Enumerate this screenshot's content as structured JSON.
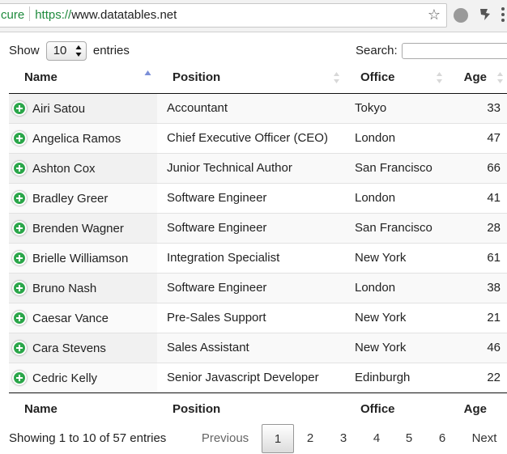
{
  "browser": {
    "secure_label": "cure",
    "url_scheme": "https://",
    "url_host": "www.datatables.net",
    "icons": [
      "star-icon",
      "extension-icon",
      "pin-extension-icon",
      "menu-icon"
    ]
  },
  "controls": {
    "length_prefix": "Show",
    "length_value": "10",
    "length_suffix": "entries",
    "search_label": "Search:",
    "search_value": ""
  },
  "table": {
    "columns": [
      {
        "label": "Name",
        "sorted": "asc"
      },
      {
        "label": "Position"
      },
      {
        "label": "Office"
      },
      {
        "label": "Age"
      }
    ],
    "rows": [
      {
        "name": "Airi Satou",
        "position": "Accountant",
        "office": "Tokyo",
        "age": "33"
      },
      {
        "name": "Angelica Ramos",
        "position": "Chief Executive Officer (CEO)",
        "office": "London",
        "age": "47"
      },
      {
        "name": "Ashton Cox",
        "position": "Junior Technical Author",
        "office": "San Francisco",
        "age": "66"
      },
      {
        "name": "Bradley Greer",
        "position": "Software Engineer",
        "office": "London",
        "age": "41"
      },
      {
        "name": "Brenden Wagner",
        "position": "Software Engineer",
        "office": "San Francisco",
        "age": "28"
      },
      {
        "name": "Brielle Williamson",
        "position": "Integration Specialist",
        "office": "New York",
        "age": "61"
      },
      {
        "name": "Bruno Nash",
        "position": "Software Engineer",
        "office": "London",
        "age": "38"
      },
      {
        "name": "Caesar Vance",
        "position": "Pre-Sales Support",
        "office": "New York",
        "age": "21"
      },
      {
        "name": "Cara Stevens",
        "position": "Sales Assistant",
        "office": "New York",
        "age": "46"
      },
      {
        "name": "Cedric Kelly",
        "position": "Senior Javascript Developer",
        "office": "Edinburgh",
        "age": "22"
      }
    ],
    "footer": [
      "Name",
      "Position",
      "Office",
      "Age"
    ]
  },
  "info": "Showing 1 to 10 of 57 entries",
  "pagination": {
    "previous": "Previous",
    "pages": [
      "1",
      "2",
      "3",
      "4",
      "5",
      "6"
    ],
    "current": "1",
    "next": "Next"
  },
  "colors": {
    "secure_green": "#1e8a3c",
    "expand_button": "#2ba64a",
    "row_stripe": "#f9f9f9"
  }
}
